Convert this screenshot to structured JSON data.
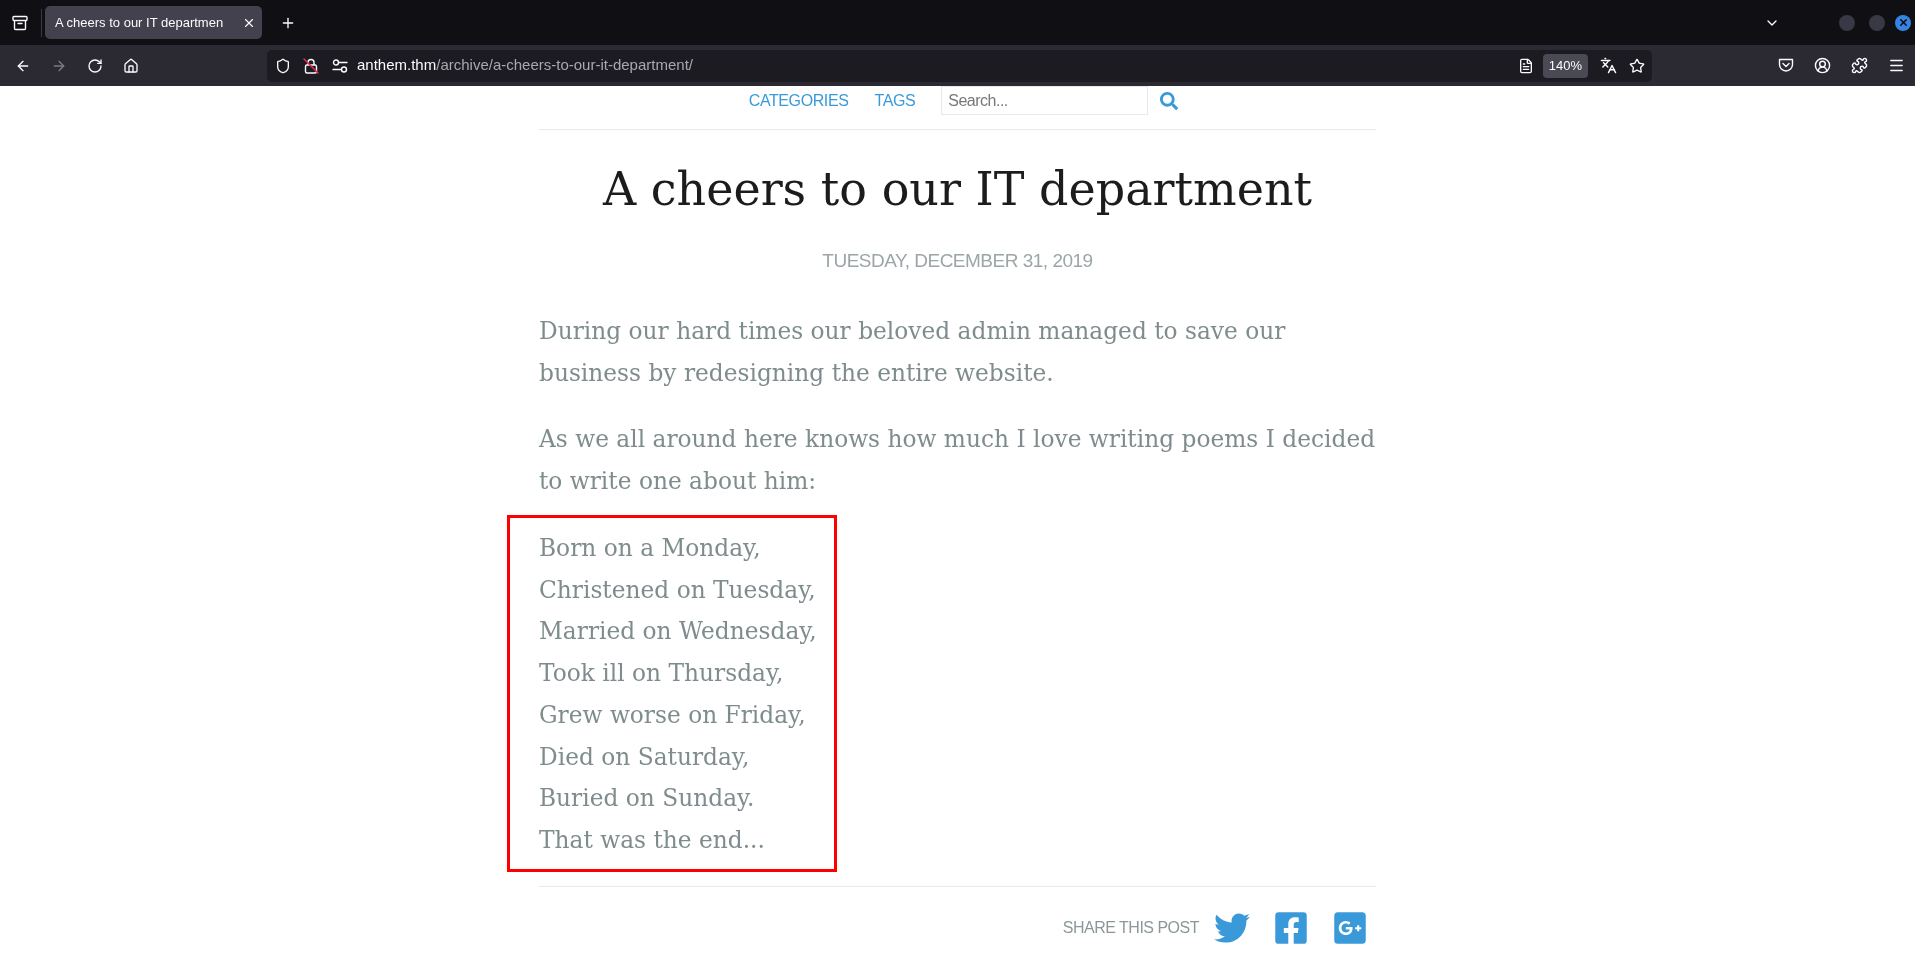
{
  "browser": {
    "tabs": [
      {
        "title": "A cheers to our IT departmen",
        "selected": true
      }
    ],
    "toolbar": {
      "forward_disabled": true
    },
    "address": {
      "host": "anthem.thm",
      "path": "/archive/a-cheers-to-our-it-department/"
    },
    "zoom": "140%"
  },
  "site_nav": {
    "links": [
      "CATEGORIES",
      "TAGS"
    ],
    "search": {
      "placeholder": "Search..."
    }
  },
  "post": {
    "title": "A cheers to our IT department",
    "date": "TUESDAY, DECEMBER 31, 2019",
    "paragraphs": [
      "During our hard times our beloved admin managed to save our business by redesigning the entire website.",
      "As we all around here knows how much I love writing poems I decided to write one about him:"
    ],
    "poem": {
      "highlighted": true,
      "lines": [
        "Born on a Monday,",
        "Christened on Tuesday,",
        "Married on Wednesday,",
        "Took ill on Thursday,",
        "Grew worse on Friday,",
        "Died on Saturday,",
        "Buried on Sunday.",
        "That was the end..."
      ]
    }
  },
  "share": {
    "label": "SHARE THIS POST",
    "networks": [
      {
        "kind": "twitter"
      },
      {
        "kind": "facebook"
      },
      {
        "kind": "googleplus"
      }
    ]
  }
}
